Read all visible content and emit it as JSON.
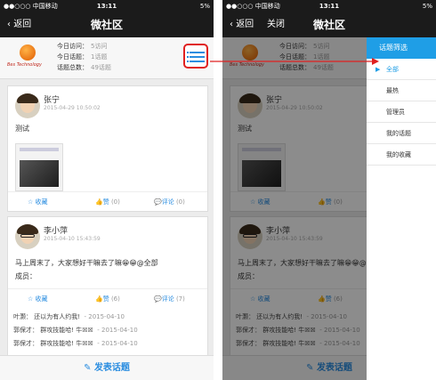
{
  "status_bar": {
    "carrier": "●●○○○ 中国移动",
    "time": "13:11",
    "battery": "5%"
  },
  "nav": {
    "back_label": "返回",
    "close_label": "关闭",
    "title": "微社区"
  },
  "header": {
    "logo_text": "Bes Technology",
    "stats": [
      {
        "label": "今日访问：",
        "value": "5访问"
      },
      {
        "label": "今日话题：",
        "value": "1话题"
      },
      {
        "label": "话题总数：",
        "value": "49话题"
      }
    ]
  },
  "posts": [
    {
      "author": "张宁",
      "time": "2015-04-29 10:50:02",
      "content": "测试",
      "actions": {
        "favorite": "收藏",
        "like": "赞",
        "like_count": "(0)",
        "comment": "评论",
        "comment_count": "(0)"
      }
    },
    {
      "author": "李小萍",
      "time": "2015-04-10 15:43:59",
      "content_line1": "马上周末了，大家想好干嘛去了嘛😁😁@全部",
      "content_line2": "成员：",
      "actions": {
        "favorite": "收藏",
        "like": "赞",
        "like_count": "(6)",
        "comment": "评论",
        "comment_count": "(7)"
      },
      "comments": [
        {
          "text": "叶灏：  还以为有人约我!",
          "date": "- 2015-04-10"
        },
        {
          "text": "郭保才：  群攻技能哈! 牛☒☒",
          "date": "- 2015-04-10"
        },
        {
          "text": "郭保才：  群攻技能哈! 牛☒☒",
          "date": "- 2015-04-10"
        }
      ]
    }
  ],
  "footer": {
    "publish_label": "发表话题"
  },
  "drawer": {
    "title": "话题筛选",
    "items": [
      "全部",
      "最热",
      "管理员",
      "我的话题",
      "我的收藏"
    ]
  },
  "colors": {
    "accent": "#2a8de0",
    "drawer_header": "#1f9ee6",
    "highlight": "#e02020",
    "bar": "#1b1b1b"
  }
}
